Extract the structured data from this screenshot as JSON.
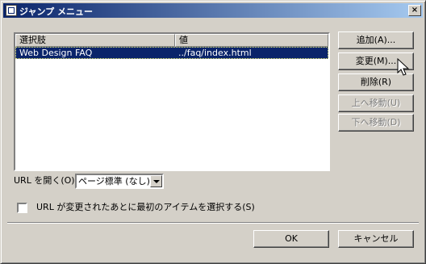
{
  "window": {
    "title": "ジャンプ メニュー",
    "close_label": "×"
  },
  "list": {
    "columns": [
      "選択肢",
      "値"
    ],
    "rows": [
      {
        "choice": "Web Design FAQ",
        "value": "../faq/index.html"
      }
    ]
  },
  "buttons": {
    "add": "追加(A)...",
    "edit": "変更(M)...",
    "delete": "削除(R)",
    "move_up": "上へ移動(U)",
    "move_down": "下へ移動(D)",
    "ok": "OK",
    "cancel": "キャンセル"
  },
  "url_open": {
    "label": "URL を開く(O):",
    "selected": "ページ標準 (なし)"
  },
  "checkbox": {
    "label": "URL が変更されたあとに最初のアイテムを選択する(S)",
    "checked": false
  },
  "icons": {
    "title": "window-icon",
    "cursor": "mouse-pointer-icon"
  }
}
